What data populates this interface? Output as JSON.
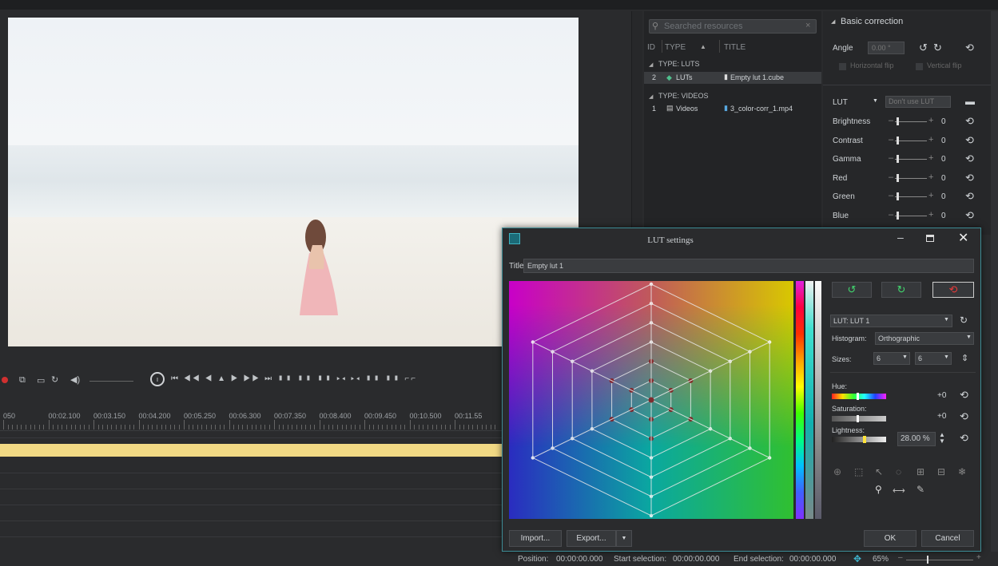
{
  "resources": {
    "search_placeholder": "Searched resources",
    "col_id": "ID",
    "col_type": "TYPE",
    "col_title": "TITLE",
    "groups": [
      {
        "label": "TYPE: LUTS",
        "items": [
          {
            "id": "2",
            "type": "LUTs",
            "title": "Empty lut 1.cube"
          }
        ]
      },
      {
        "label": "TYPE: VIDEOS",
        "items": [
          {
            "id": "1",
            "type": "Videos",
            "title": "3_color-corr_1.mp4"
          }
        ]
      }
    ]
  },
  "correction": {
    "header": "Basic correction",
    "angle_label": "Angle",
    "angle_value": "0.00 °",
    "hflip": "Horizontal flip",
    "vflip": "Vertical flip",
    "lut_label": "LUT",
    "lut_value": "Don't use LUT",
    "sliders": [
      {
        "label": "Brightness",
        "value": "0"
      },
      {
        "label": "Contrast",
        "value": "0"
      },
      {
        "label": "Gamma",
        "value": "0"
      },
      {
        "label": "Red",
        "value": "0"
      },
      {
        "label": "Green",
        "value": "0"
      },
      {
        "label": "Blue",
        "value": "0"
      }
    ]
  },
  "ruler": {
    "ticks": [
      "050",
      "00:02.100",
      "00:03.150",
      "00:04.200",
      "00:05.250",
      "00:06.300",
      "00:07.350",
      "00:08.400",
      "00:09.450",
      "00:10.500",
      "00:11.55"
    ]
  },
  "dialog": {
    "title": "LUT settings",
    "title_label": "Title:",
    "title_value": "Empty lut 1",
    "lut_select": "LUT: LUT 1",
    "histogram_label": "Histogram:",
    "histogram_value": "Orthographic",
    "sizes_label": "Sizes:",
    "size_a": "6",
    "size_b": "6",
    "hue_label": "Hue:",
    "hue_value": "+0",
    "saturation_label": "Saturation:",
    "saturation_value": "+0",
    "lightness_label": "Lightness:",
    "lightness_value": "28.00 %",
    "import": "Import...",
    "export": "Export...",
    "ok": "OK",
    "cancel": "Cancel",
    "swap_glyph": "⟷"
  },
  "status": {
    "position_label": "Position:",
    "position_value": "00:00:00.000",
    "start_label": "Start selection:",
    "start_value": "00:00:00.000",
    "end_label": "End selection:",
    "end_value": "00:00:00.000",
    "zoom": "65%"
  }
}
